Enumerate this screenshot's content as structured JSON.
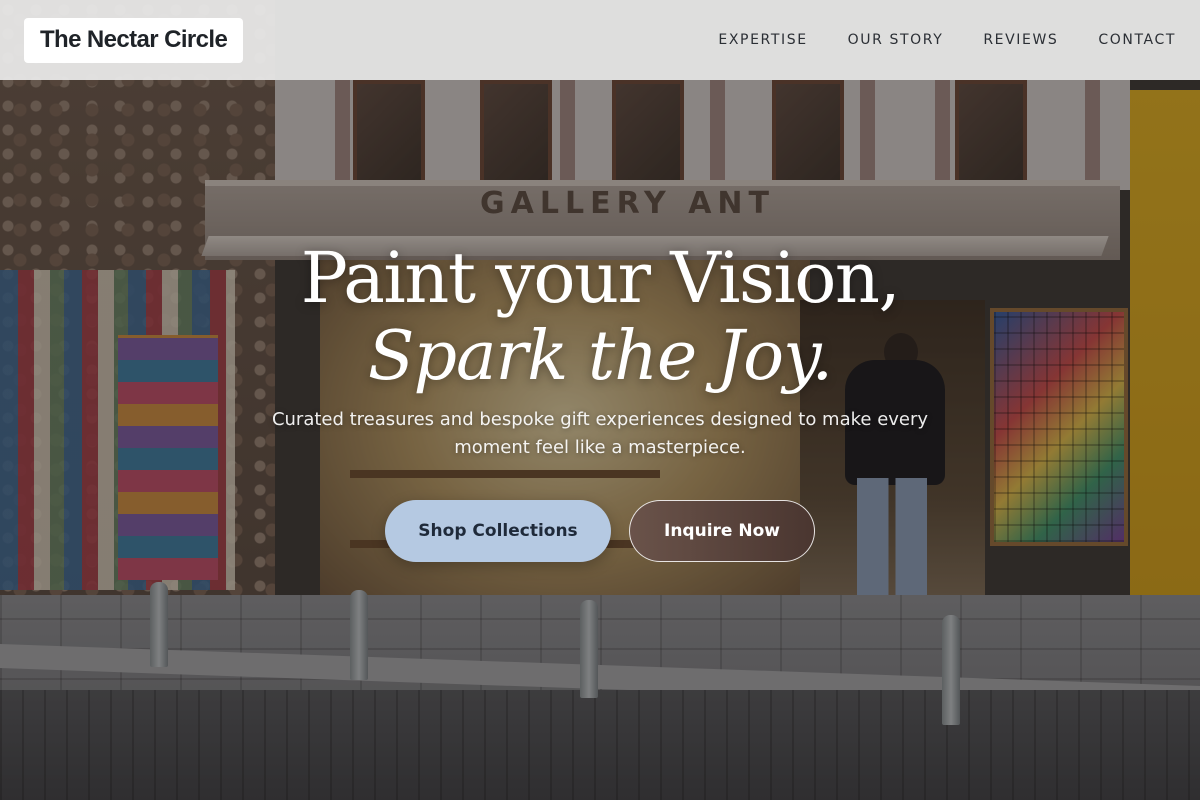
{
  "header": {
    "brand": "The Nectar Circle",
    "nav": [
      "EXPERTISE",
      "OUR STORY",
      "REVIEWS",
      "CONTACT"
    ]
  },
  "hero": {
    "title_line1": "Paint your Vision,",
    "title_line2": "Spark the Joy.",
    "subtitle": "Curated treasures and bespoke gift experiences designed to make every moment feel like a masterpiece.",
    "primary_cta": "Shop Collections",
    "secondary_cta": "Inquire Now",
    "background_sign": "GALLERY ANT"
  },
  "colors": {
    "primary_button": "#b5c9e2",
    "secondary_button": "#5a443d",
    "header_bg": "#ececec"
  }
}
